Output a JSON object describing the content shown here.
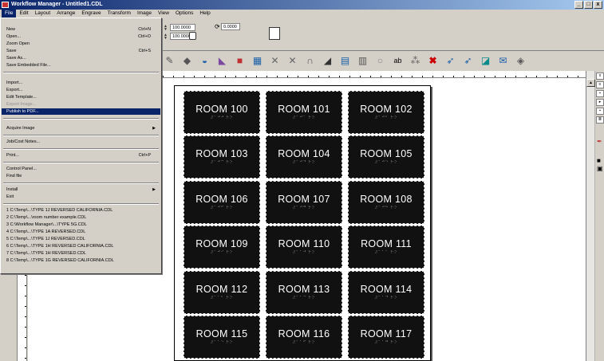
{
  "window": {
    "title": "Workflow Manager - Untitled1.CDL",
    "buttons": [
      "_",
      "□",
      "x"
    ]
  },
  "menubar": [
    "File",
    "Edit",
    "Layout",
    "Arrange",
    "Engrave",
    "Transform",
    "Image",
    "View",
    "Options",
    "Help"
  ],
  "toolbar": {
    "width_value": "100.0000",
    "height_value": "100.0000",
    "rotation_value": "0.0000"
  },
  "file_menu": {
    "new": {
      "label": "New",
      "shortcut": "Ctrl+N"
    },
    "open": {
      "label": "Open...",
      "shortcut": "Ctrl+O"
    },
    "zoom_open": {
      "label": "Zoom Open"
    },
    "save": {
      "label": "Save",
      "shortcut": "Ctrl+S"
    },
    "save_as": {
      "label": "Save As..."
    },
    "save_embedded": {
      "label": "Save Embedded File..."
    },
    "import": {
      "label": "Import..."
    },
    "export": {
      "label": "Export..."
    },
    "edit_template": {
      "label": "Edit Template..."
    },
    "export_image": {
      "label": "Export Image..."
    },
    "publish_pdf": {
      "label": "Publish to PDF..."
    },
    "acquire_image": {
      "label": "Acquire Image"
    },
    "job_cost": {
      "label": "Job/Cost Notes..."
    },
    "print": {
      "label": "Print...",
      "shortcut": "Ctrl+P"
    },
    "control_panel": {
      "label": "Control Panel..."
    },
    "find_file": {
      "label": "Find file"
    },
    "install": {
      "label": "Install"
    },
    "exit": {
      "label": "Exit"
    },
    "recent": [
      "1 C:\\Temp\\...\\TYPE 1J REVERSED CALIFORNIA.CDL",
      "2 C:\\Temp\\...\\room number example.CDL",
      "3 C:\\Workflow Manager\\...\\TYPE 5G.CDL",
      "4 C:\\Temp\\...\\TYPE 1A REVERSED.CDL",
      "5 C:\\Temp\\...\\TYPE 1J REVERSED.CDL",
      "6 C:\\Temp\\...\\TYPE 1H REVERSED CALIFORNIA.CDL",
      "7 C:\\Temp\\...\\TYPE 1H REVERSED.CDL",
      "8 C:\\Temp\\...\\TYPE 1G REVERSED CALIFORNIA.CDL"
    ]
  },
  "signs": [
    {
      "label": "ROOM 100",
      "braille": "⠼⠁⠚⠚ ⠗⠕"
    },
    {
      "label": "ROOM 101",
      "braille": "⠼⠁⠚⠁ ⠗⠕"
    },
    {
      "label": "ROOM 102",
      "braille": "⠼⠁⠚⠃ ⠗⠕"
    },
    {
      "label": "ROOM 103",
      "braille": "⠼⠁⠚⠉ ⠗⠕"
    },
    {
      "label": "ROOM 104",
      "braille": "⠼⠁⠚⠙ ⠗⠕"
    },
    {
      "label": "ROOM 105",
      "braille": "⠼⠁⠚⠑ ⠗⠕"
    },
    {
      "label": "ROOM 106",
      "braille": "⠼⠁⠚⠋ ⠗⠕"
    },
    {
      "label": "ROOM 107",
      "braille": "⠼⠁⠚⠛ ⠗⠕"
    },
    {
      "label": "ROOM 108",
      "braille": "⠼⠁⠚⠓ ⠗⠕"
    },
    {
      "label": "ROOM 109",
      "braille": "⠼⠁⠚⠊ ⠗⠕"
    },
    {
      "label": "ROOM 110",
      "braille": "⠼⠁⠁⠚ ⠗⠕"
    },
    {
      "label": "ROOM 111",
      "braille": "⠼⠁⠁⠁ ⠗⠕"
    },
    {
      "label": "ROOM 112",
      "braille": "⠼⠁⠁⠃ ⠗⠕"
    },
    {
      "label": "ROOM 113",
      "braille": "⠼⠁⠁⠉ ⠗⠕"
    },
    {
      "label": "ROOM 114",
      "braille": "⠼⠁⠁⠙ ⠗⠕"
    },
    {
      "label": "ROOM 115",
      "braille": "⠼⠁⠁⠑ ⠗⠕"
    },
    {
      "label": "ROOM 116",
      "braille": "⠼⠁⠁⠋ ⠗⠕"
    },
    {
      "label": "ROOM 117",
      "braille": "⠼⠁⠁⠛ ⠗⠕"
    }
  ],
  "toolbar_icons": [
    "pencil-icon",
    "diamond-icon",
    "bucket-icon",
    "shape-icon",
    "color-icon",
    "image-icon",
    "node-icon",
    "node2-icon",
    "curve-icon",
    "shadow-icon",
    "grid-icon",
    "layout-icon",
    "circle-icon",
    "text-icon",
    "text2-icon",
    "delete-icon",
    "cursor-icon",
    "cursor2-icon",
    "erase-icon",
    "mail-icon",
    "engrave-icon"
  ]
}
